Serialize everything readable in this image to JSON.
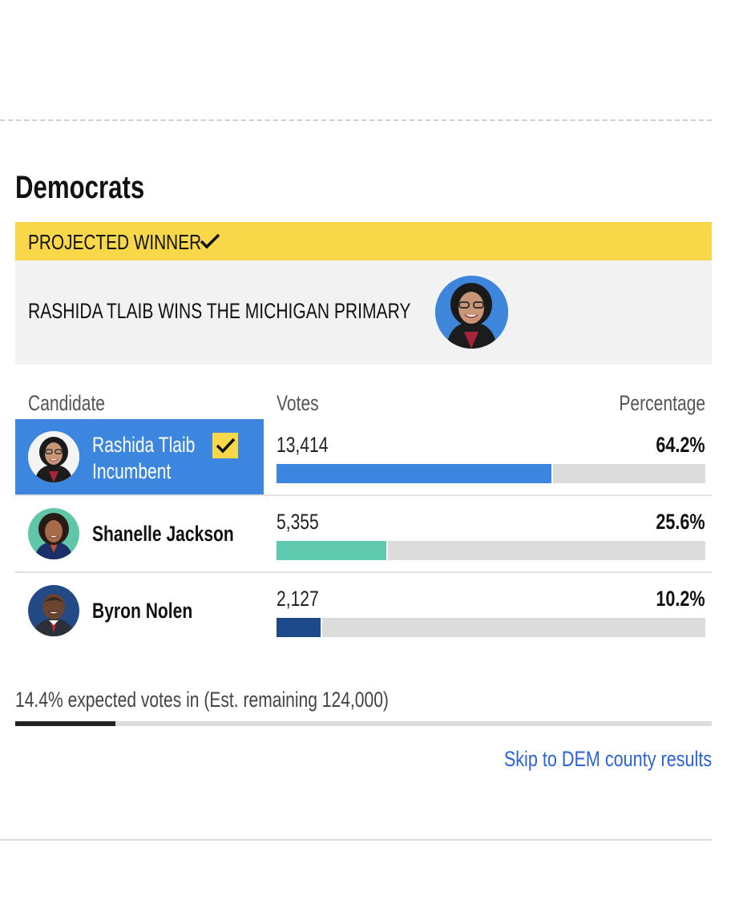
{
  "section": {
    "title": "Democrats"
  },
  "banner": {
    "label": "PROJECTED WINNER",
    "headline": "RASHIDA TLAIB WINS THE MICHIGAN PRIMARY"
  },
  "table": {
    "headers": {
      "candidate": "Candidate",
      "votes": "Votes",
      "percentage": "Percentage"
    },
    "rows": [
      {
        "name": "Rashida Tlaib",
        "subtitle": "Incumbent",
        "votes": "13,414",
        "percentage": "64.2%",
        "share": 64.2,
        "bar_color": "#3c86e0",
        "winner": true
      },
      {
        "name": "Shanelle Jackson",
        "votes": "5,355",
        "percentage": "25.6%",
        "share": 25.6,
        "bar_color": "#5fcaae",
        "winner": false
      },
      {
        "name": "Byron Nolen",
        "votes": "2,127",
        "percentage": "10.2%",
        "share": 10.2,
        "bar_color": "#1e4a8c",
        "winner": false
      }
    ]
  },
  "expected": {
    "text": "14.4% expected votes in (Est. remaining 124,000)",
    "share": 14.4
  },
  "links": {
    "skip": "Skip to DEM county results"
  },
  "colors": {
    "winner_yellow": "#f8d748",
    "winner_blue": "#3c86e0",
    "link_blue": "#2b63d9"
  }
}
